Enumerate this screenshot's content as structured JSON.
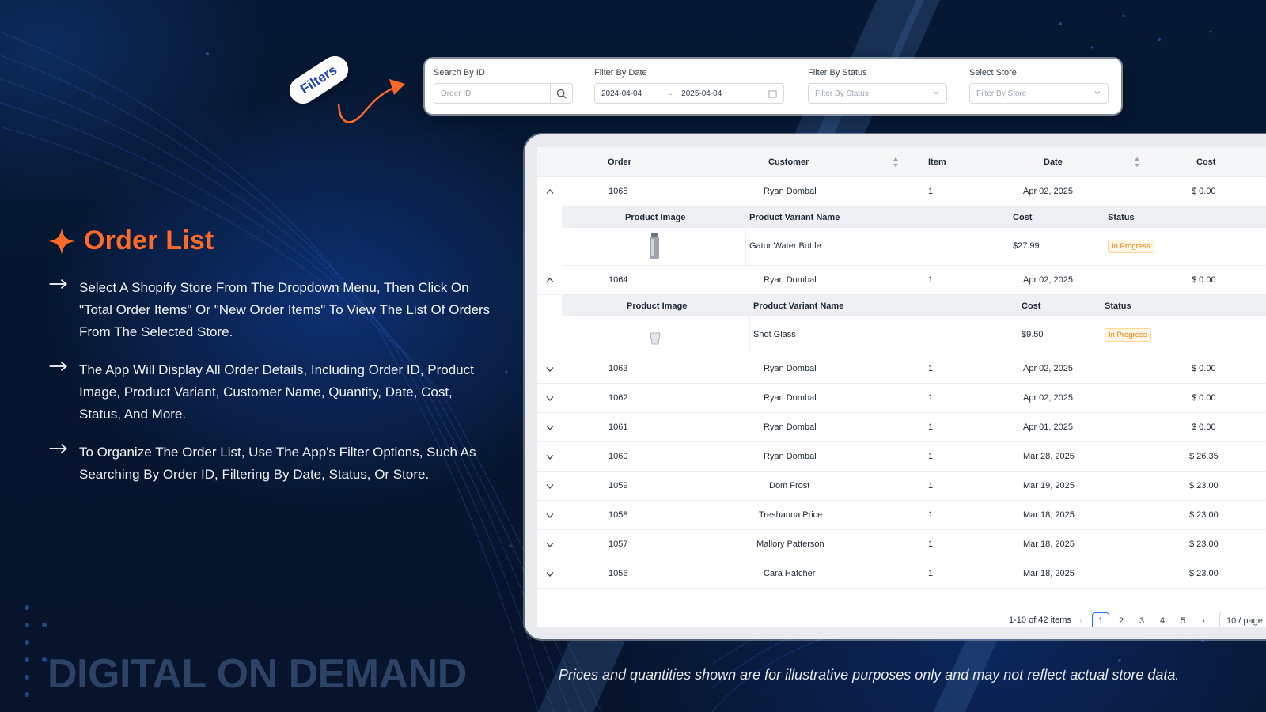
{
  "filters_tag": "Filters",
  "filters": {
    "search_label": "Search By ID",
    "search_placeholder": "Order ID",
    "date_label": "Filter By Date",
    "date_start": "2024-04-04",
    "date_end": "2025-04-04",
    "status_label": "Filter By Status",
    "status_placeholder": "Filter By Status",
    "store_label": "Select Store",
    "store_placeholder": "Filter By Store"
  },
  "heading": "Order List",
  "bullets": [
    "Select A Shopify Store From The Dropdown Menu, Then Click On \"Total Order Items\" Or \"New Order Items\" To View The List Of Orders From The Selected Store.",
    "The App Will Display All Order Details, Including Order ID, Product Image, Product Variant, Customer Name, Quantity, Date, Cost, Status, And More.",
    "To Organize The Order List, Use The App's Filter Options, Such As Searching By Order ID, Filtering By Date, Status, Or Store."
  ],
  "brand": "DIGITAL ON DEMAND",
  "disclaimer": "Prices and quantities shown are for illustrative purposes only and may not reflect actual store data.",
  "table": {
    "columns": [
      "Order",
      "Customer",
      "Item",
      "Date",
      "Cost"
    ],
    "sub_columns": [
      "Product Image",
      "Product Variant Name",
      "Cost",
      "Status"
    ],
    "rows": [
      {
        "order": "1065",
        "customer": "Ryan Dombal",
        "item": "1",
        "date": "Apr 02, 2025",
        "cost": "$ 0.00",
        "expanded": true,
        "sub": {
          "variant": "Gator Water Bottle",
          "cost": "$27.99",
          "status": "In Progress",
          "image": "bottle"
        }
      },
      {
        "order": "1064",
        "customer": "Ryan Dombal",
        "item": "1",
        "date": "Apr 02, 2025",
        "cost": "$ 0.00",
        "expanded": true,
        "sub": {
          "variant": "Shot Glass",
          "cost": "$9.50",
          "status": "In Progress",
          "image": "glass"
        }
      },
      {
        "order": "1063",
        "customer": "Ryan Dombal",
        "item": "1",
        "date": "Apr 02, 2025",
        "cost": "$ 0.00"
      },
      {
        "order": "1062",
        "customer": "Ryan Dombal",
        "item": "1",
        "date": "Apr 02, 2025",
        "cost": "$ 0.00"
      },
      {
        "order": "1061",
        "customer": "Ryan Dombal",
        "item": "1",
        "date": "Apr 01, 2025",
        "cost": "$ 0.00"
      },
      {
        "order": "1060",
        "customer": "Ryan Dombal",
        "item": "1",
        "date": "Mar 28, 2025",
        "cost": "$ 26.35"
      },
      {
        "order": "1059",
        "customer": "Dom Frost",
        "item": "1",
        "date": "Mar 19, 2025",
        "cost": "$ 23.00"
      },
      {
        "order": "1058",
        "customer": "Treshauna Price",
        "item": "1",
        "date": "Mar 18, 2025",
        "cost": "$ 23.00"
      },
      {
        "order": "1057",
        "customer": "Mallory Patterson",
        "item": "1",
        "date": "Mar 18, 2025",
        "cost": "$ 23.00"
      },
      {
        "order": "1056",
        "customer": "Cara Hatcher",
        "item": "1",
        "date": "Mar 18, 2025",
        "cost": "$ 23.00"
      }
    ]
  },
  "pagination": {
    "summary": "1-10 of 42 items",
    "pages": [
      "1",
      "2",
      "3",
      "4",
      "5"
    ],
    "current": "1",
    "page_size": "10 / page"
  },
  "colors": {
    "accent": "#ff6a2b",
    "background": "#061630",
    "status": "#e8830c"
  }
}
